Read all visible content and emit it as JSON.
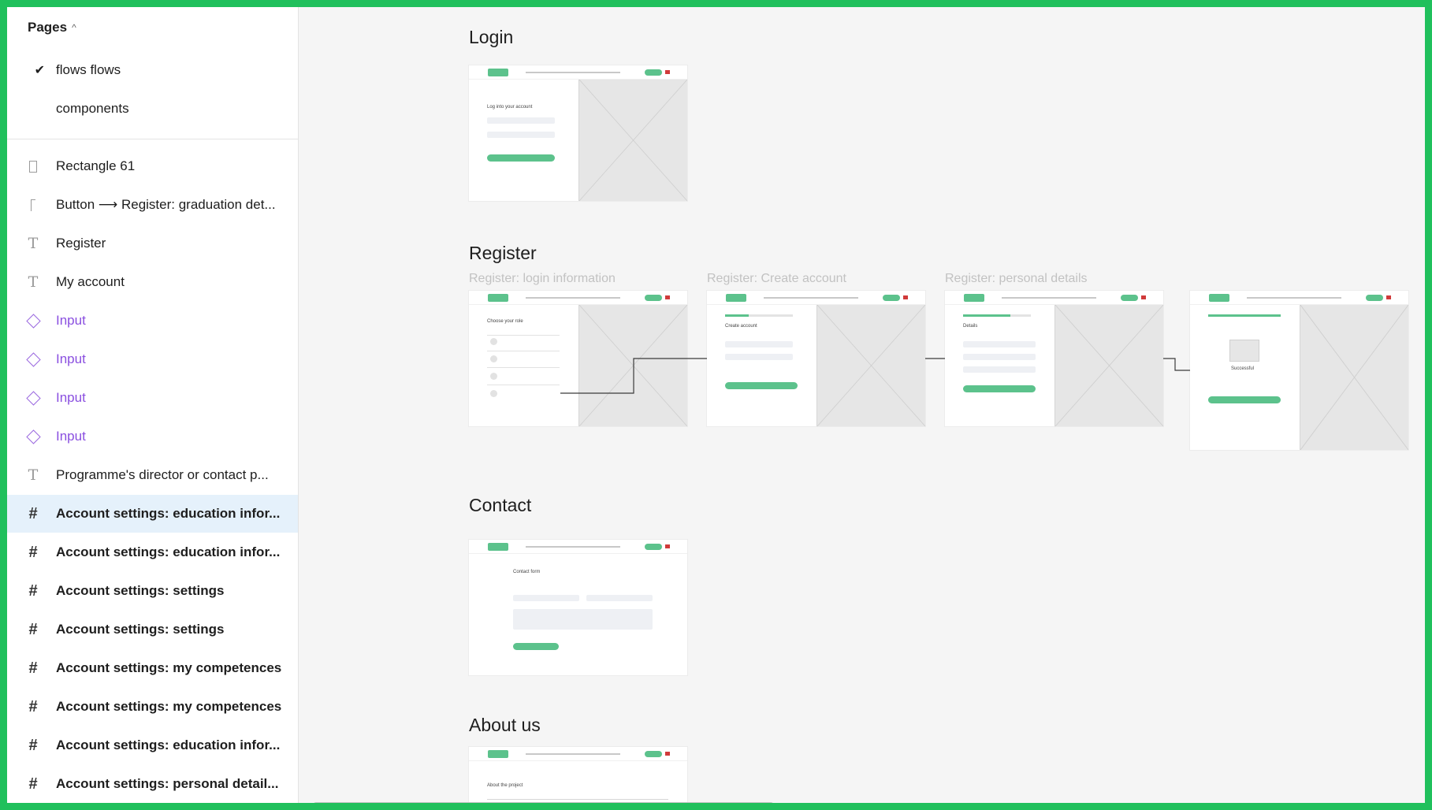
{
  "pages": {
    "header": "Pages",
    "items": [
      {
        "label": "flows flows",
        "checked": true
      },
      {
        "label": "components",
        "checked": false
      }
    ]
  },
  "layers": [
    {
      "label": "Rectangle 61",
      "type": "rectangle-icon"
    },
    {
      "label": "Button ⟶ Register: graduation det...",
      "type": "line-icon"
    },
    {
      "label": "Register",
      "type": "text-icon"
    },
    {
      "label": "My account",
      "type": "text-icon"
    },
    {
      "label": "Input",
      "type": "component-icon"
    },
    {
      "label": "Input",
      "type": "component-icon"
    },
    {
      "label": "Input",
      "type": "component-icon"
    },
    {
      "label": "Input",
      "type": "component-icon"
    },
    {
      "label": "Programme's director or contact p...",
      "type": "text-icon"
    },
    {
      "label": "Account settings: education infor...",
      "type": "frame-icon",
      "selected": true
    },
    {
      "label": "Account settings: education infor...",
      "type": "frame-icon"
    },
    {
      "label": "Account settings: settings",
      "type": "frame-icon"
    },
    {
      "label": "Account settings: settings",
      "type": "frame-icon"
    },
    {
      "label": "Account settings: my competences",
      "type": "frame-icon"
    },
    {
      "label": "Account settings: my competences",
      "type": "frame-icon"
    },
    {
      "label": "Account settings: education infor...",
      "type": "frame-icon"
    },
    {
      "label": "Account settings: personal detail...",
      "type": "frame-icon"
    }
  ],
  "canvas": {
    "sections": {
      "login": "Login",
      "register": "Register",
      "contact": "Contact",
      "about": "About us"
    },
    "frame_labels": {
      "reg_login": "Register: login information",
      "reg_create": "Register: Create account",
      "reg_personal": "Register: personal details"
    },
    "mock_text": {
      "login_heading": "Log into your account",
      "choose_role": "Choose your role",
      "create_account": "Create account",
      "details": "Details",
      "successful": "Successful",
      "contact_form": "Contact form",
      "about_project": "About the project"
    }
  },
  "colors": {
    "accent_border": "#20c05c",
    "selected_row": "#e5f1fb",
    "component_purple": "#8a4fe0",
    "mock_green": "#5cc28c"
  }
}
